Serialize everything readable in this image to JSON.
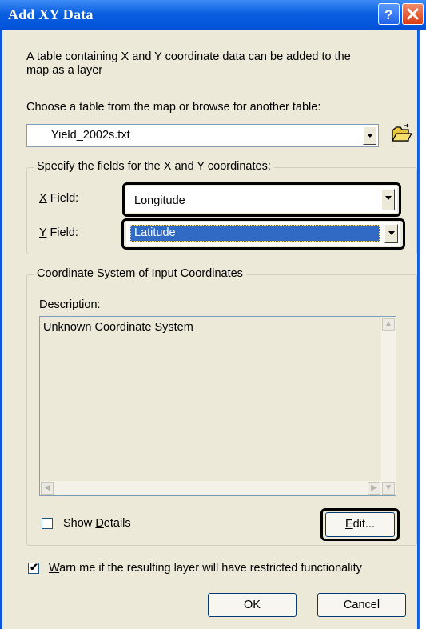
{
  "window": {
    "title": "Add XY Data"
  },
  "intro": {
    "line1": "A table containing X and Y coordinate data can be added to the",
    "line2": "map as a layer"
  },
  "table_chooser": {
    "label": "Choose a table from the map or browse for another table:",
    "selected": "Yield_2002s.txt",
    "browse_icon": "folder-open-icon"
  },
  "fields_group": {
    "legend": "Specify the fields for the X and Y coordinates:",
    "x_label_hot": "X",
    "x_label_rest": " Field:",
    "x_value": "Longitude",
    "y_label_hot": "Y",
    "y_label_rest": " Field:",
    "y_value": "Latitude"
  },
  "coord_group": {
    "legend": "Coordinate System of Input Coordinates",
    "description_label": "Description:",
    "description_text": "Unknown Coordinate System",
    "show_details_pre": "Show ",
    "show_details_hot": "D",
    "show_details_post": "etails",
    "show_details_checked": false,
    "edit_hot": "E",
    "edit_rest": "dit..."
  },
  "warn": {
    "checked": true,
    "hot": "W",
    "rest": "arn me if the resulting layer will have restricted functionality"
  },
  "buttons": {
    "ok": "OK",
    "cancel": "Cancel"
  },
  "colors": {
    "titlebar": "#0a5ee0",
    "selection": "#316ac5",
    "face": "#ece9d8"
  }
}
